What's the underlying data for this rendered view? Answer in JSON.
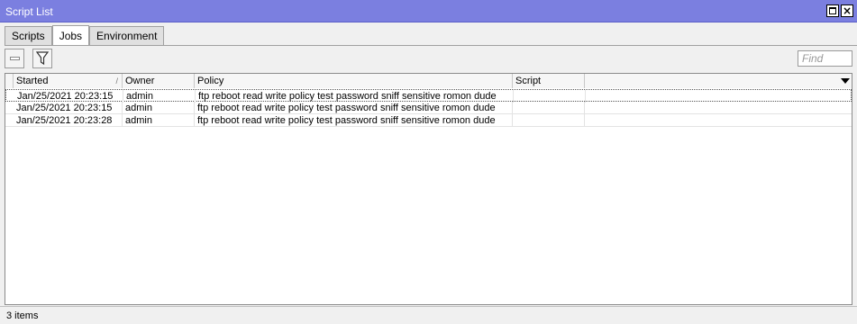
{
  "window": {
    "title": "Script List"
  },
  "tabs": [
    {
      "label": "Scripts"
    },
    {
      "label": "Jobs"
    },
    {
      "label": "Environment"
    }
  ],
  "toolbar": {
    "find_placeholder": "Find"
  },
  "table": {
    "columns": [
      "Started",
      "Owner",
      "Policy",
      "Script"
    ],
    "rows": [
      {
        "started": "Jan/25/2021 20:23:15",
        "owner": "admin",
        "policy": "ftp reboot read write policy test password sniff sensitive romon dude",
        "script": ""
      },
      {
        "started": "Jan/25/2021 20:23:15",
        "owner": "admin",
        "policy": "ftp reboot read write policy test password sniff sensitive romon dude",
        "script": ""
      },
      {
        "started": "Jan/25/2021 20:23:28",
        "owner": "admin",
        "policy": "ftp reboot read write policy test password sniff sensitive romon dude",
        "script": ""
      }
    ]
  },
  "status": {
    "text": "3 items"
  },
  "colors": {
    "titlebar": "#7b7fe0"
  }
}
